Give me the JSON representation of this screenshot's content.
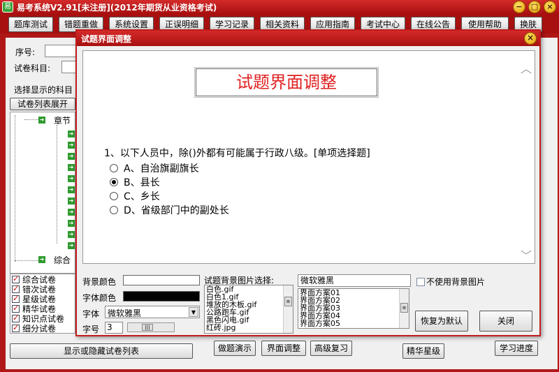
{
  "app": {
    "title": "易考系统V2.91[未注册](2012年期货从业资格考试)",
    "icon": "book-icon"
  },
  "window_controls": {
    "minimize": "−",
    "maximize": "□",
    "close": "×"
  },
  "toolbar": [
    "题库测试",
    "错题重做",
    "系统设置",
    "正误明细",
    "学习记录",
    "相关资料",
    "应用指南",
    "考试中心",
    "在线公告",
    "使用帮助",
    "换肤"
  ],
  "main": {
    "seq_label": "序号:",
    "subject_label": "试卷科目:",
    "choose_label": "选择显示的科目",
    "expand_button": "试卷列表展开",
    "tree": {
      "chapter": "章节",
      "general": "综合"
    },
    "checklist": [
      "综合试卷",
      "错次试卷",
      "星级试卷",
      "精华试卷",
      "知识点试卷",
      "细分试卷"
    ],
    "toggle_button": "显示或隐藏试卷列表",
    "bottom_buttons": [
      "做题演示",
      "界面调整",
      "高级复习",
      "精华星级",
      "学习进度"
    ]
  },
  "dialog": {
    "title": "试题界面调整",
    "heading": "试题界面调整",
    "question": "1、以下人员中，除()外都有可能属于行政八级。[单项选择题]",
    "options": [
      {
        "text": "A、自治旗副旗长",
        "selected": false
      },
      {
        "text": "B、县长",
        "selected": true
      },
      {
        "text": "C、乡长",
        "selected": false
      },
      {
        "text": "D、省级部门中的副处长",
        "selected": false
      }
    ],
    "bg_color_label": "背景颜色",
    "font_color_label": "字体颜色",
    "font_label": "字体",
    "font_value": "微软雅黑",
    "size_label": "字号",
    "size_value": "3",
    "bg_image_label": "试题背景图片选择:",
    "bg_images": [
      "白色.gif",
      "白色1.gif",
      "堆放的木板.gif",
      "公路跑车.gif",
      "黑色闪电.gif",
      "红砖.jpg"
    ],
    "scheme_font": "微软雅黑",
    "schemes": [
      "界面方案01",
      "界面方案02",
      "界面方案03",
      "界面方案04",
      "界面方案05"
    ],
    "no_bg_label": "不使用背景图片",
    "restore_button": "恢复为默认",
    "close_button": "关闭",
    "colors": {
      "bg": "#ffffff",
      "font": "#000000",
      "heading": "#e02020"
    }
  }
}
